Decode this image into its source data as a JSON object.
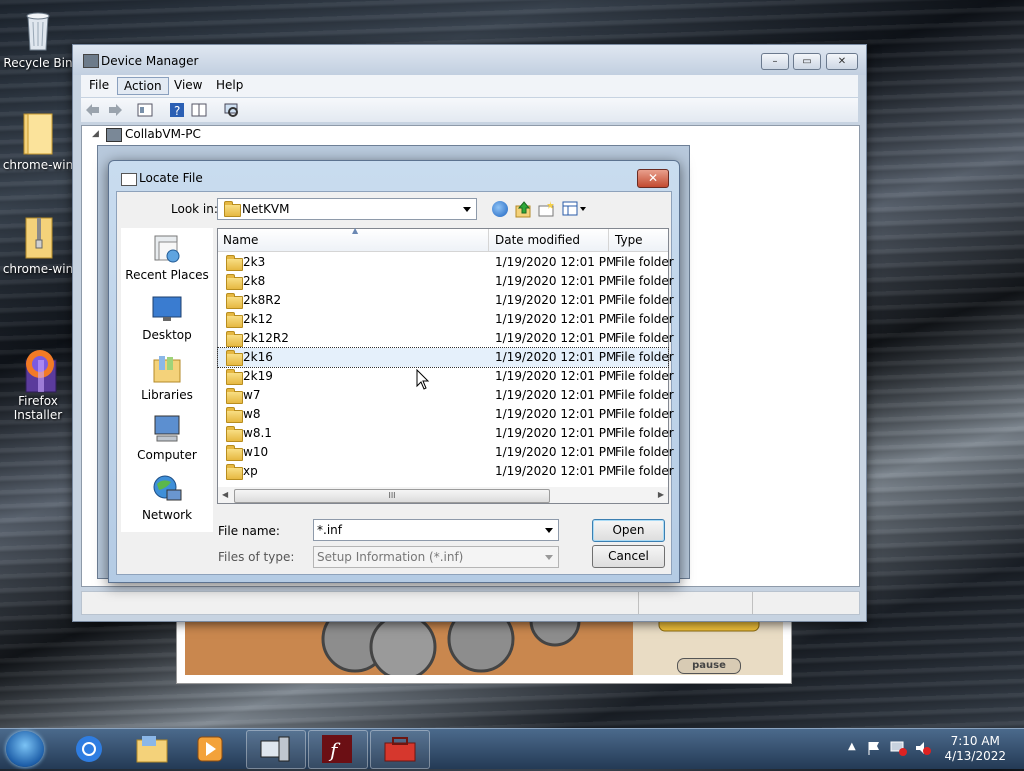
{
  "desktop": {
    "icons": [
      {
        "label": "Recycle Bin",
        "icon": "recycle-bin-icon"
      },
      {
        "label": "chrome-win",
        "icon": "folder-icon"
      },
      {
        "label": "chrome-win",
        "icon": "zip-folder-icon"
      },
      {
        "label": "Firefox\nInstaller",
        "icon": "firefox-installer-icon"
      }
    ]
  },
  "device_manager": {
    "title": "Device Manager",
    "menu": [
      "File",
      "Action",
      "View",
      "Help"
    ],
    "active_menu": "Action",
    "tree_root": "CollabVM-PC"
  },
  "dialog": {
    "title": "Locate File",
    "look_in_label": "Look in:",
    "look_in_value": "NetKVM",
    "places": [
      "Recent Places",
      "Desktop",
      "Libraries",
      "Computer",
      "Network"
    ],
    "columns": [
      "Name",
      "Date modified",
      "Type"
    ],
    "files": [
      {
        "name": "2k3",
        "date": "1/19/2020 12:01 PM",
        "type": "File folder"
      },
      {
        "name": "2k8",
        "date": "1/19/2020 12:01 PM",
        "type": "File folder"
      },
      {
        "name": "2k8R2",
        "date": "1/19/2020 12:01 PM",
        "type": "File folder"
      },
      {
        "name": "2k12",
        "date": "1/19/2020 12:01 PM",
        "type": "File folder"
      },
      {
        "name": "2k12R2",
        "date": "1/19/2020 12:01 PM",
        "type": "File folder"
      },
      {
        "name": "2k16",
        "date": "1/19/2020 12:01 PM",
        "type": "File folder"
      },
      {
        "name": "2k19",
        "date": "1/19/2020 12:01 PM",
        "type": "File folder"
      },
      {
        "name": "w7",
        "date": "1/19/2020 12:01 PM",
        "type": "File folder"
      },
      {
        "name": "w8",
        "date": "1/19/2020 12:01 PM",
        "type": "File folder"
      },
      {
        "name": "w8.1",
        "date": "1/19/2020 12:01 PM",
        "type": "File folder"
      },
      {
        "name": "w10",
        "date": "1/19/2020 12:01 PM",
        "type": "File folder"
      },
      {
        "name": "xp",
        "date": "1/19/2020 12:01 PM",
        "type": "File folder"
      }
    ],
    "selected_file": "2k16",
    "file_name_label": "File name:",
    "file_name_value": "*.inf",
    "file_type_label": "Files of type:",
    "file_type_value": "Setup Information (*.inf)",
    "open_label": "Open",
    "cancel_label": "Cancel",
    "scroll_grip": "III"
  },
  "game": {
    "pause_label": "pause"
  },
  "taskbar": {
    "time": "7:10 AM",
    "date": "4/13/2022",
    "pinned": [
      "chrome-icon",
      "explorer-icon",
      "media-player-icon",
      "device-manager-icon",
      "flash-icon",
      "toolbox-icon"
    ]
  }
}
